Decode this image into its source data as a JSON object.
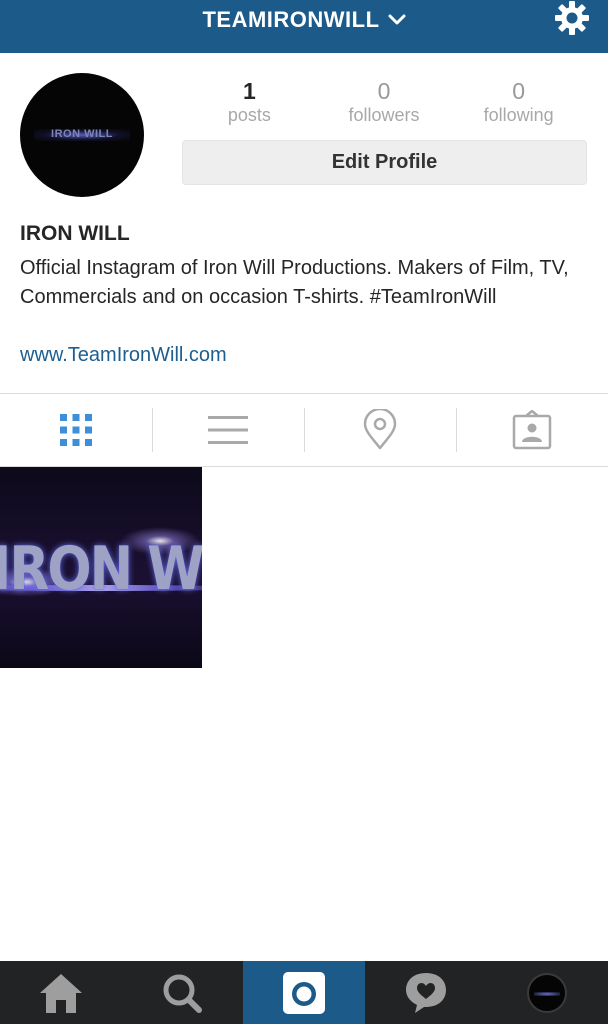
{
  "header": {
    "username": "TEAMIRONWILL",
    "dropdown_icon": "chevron-down-icon",
    "settings_icon": "gear-icon"
  },
  "profile": {
    "avatar_text": "IRON WILL",
    "stats": [
      {
        "value": "1",
        "label": "posts"
      },
      {
        "value": "0",
        "label": "followers"
      },
      {
        "value": "0",
        "label": "following"
      }
    ],
    "edit_button_label": "Edit Profile",
    "name": "IRON WILL",
    "bio": "Official Instagram of Iron Will Productions. Makers of Film, TV, Commercials and on occasion T-shirts. #TeamIronWill",
    "website": "www.TeamIronWill.com"
  },
  "view_tabs": [
    {
      "icon": "grid-icon",
      "active": true
    },
    {
      "icon": "list-icon",
      "active": false
    },
    {
      "icon": "location-pin-icon",
      "active": false
    },
    {
      "icon": "tagged-photos-icon",
      "active": false
    }
  ],
  "posts": [
    {
      "caption_text": "IRON WILL"
    }
  ],
  "bottom_nav": [
    {
      "icon": "home-icon",
      "active": false
    },
    {
      "icon": "search-icon",
      "active": false
    },
    {
      "icon": "camera-icon",
      "active": true
    },
    {
      "icon": "activity-heart-icon",
      "active": false
    },
    {
      "icon": "profile-avatar-icon",
      "active": false
    }
  ],
  "colors": {
    "brand_blue": "#1c5a8a",
    "link_blue": "#1d5e90",
    "active_tab_blue": "#3d8fd8",
    "bottom_bar": "#212325"
  }
}
